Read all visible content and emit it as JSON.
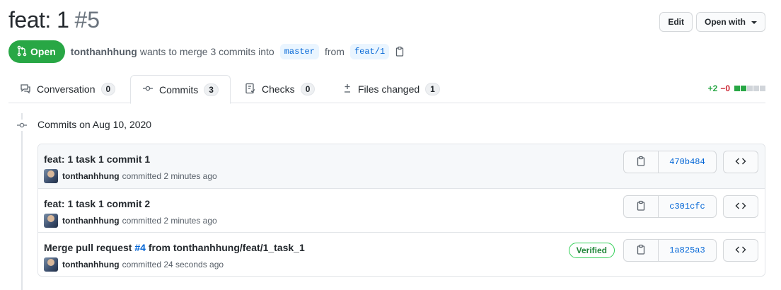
{
  "pr": {
    "title": "feat: 1",
    "number": "#5",
    "state": "Open",
    "author": "tonthanhhung",
    "merge_text": "wants to merge 3 commits into",
    "base_branch": "master",
    "from_text": "from",
    "head_branch": "feat/1"
  },
  "header_actions": {
    "edit_label": "Edit",
    "open_with_label": "Open with"
  },
  "tabs": [
    {
      "label": "Conversation",
      "count": "0",
      "icon": "comment-icon"
    },
    {
      "label": "Commits",
      "count": "3",
      "icon": "commit-icon",
      "active": true
    },
    {
      "label": "Checks",
      "count": "0",
      "icon": "checklist-icon"
    },
    {
      "label": "Files changed",
      "count": "1",
      "icon": "diff-icon"
    }
  ],
  "diffstat": {
    "additions": "+2",
    "deletions": "−0",
    "blocks": [
      "add",
      "add",
      "neutral",
      "neutral",
      "neutral"
    ]
  },
  "timeline": {
    "date_header": "Commits on Aug 10, 2020"
  },
  "commits": [
    {
      "title": "feat: 1 task 1 commit 1",
      "author": "tonthanhhung",
      "time": "committed 2 minutes ago",
      "sha": "470b484",
      "verified": false
    },
    {
      "title": "feat: 1 task 1 commit 2",
      "author": "tonthanhhung",
      "time": "committed 2 minutes ago",
      "sha": "c301cfc",
      "verified": false
    },
    {
      "title_prefix": "Merge pull request",
      "title_issue": "#4",
      "title_suffix": "from tonthanhhung/feat/1_task_1",
      "author": "tonthanhhung",
      "time": "committed 24 seconds ago",
      "sha": "1a825a3",
      "verified": true,
      "verified_label": "Verified"
    }
  ],
  "colors": {
    "open_green": "#28a745",
    "link_blue": "#0366d6",
    "add_green": "#28a745",
    "del_red": "#cb2431",
    "neutral_block": "#d1d5da"
  }
}
